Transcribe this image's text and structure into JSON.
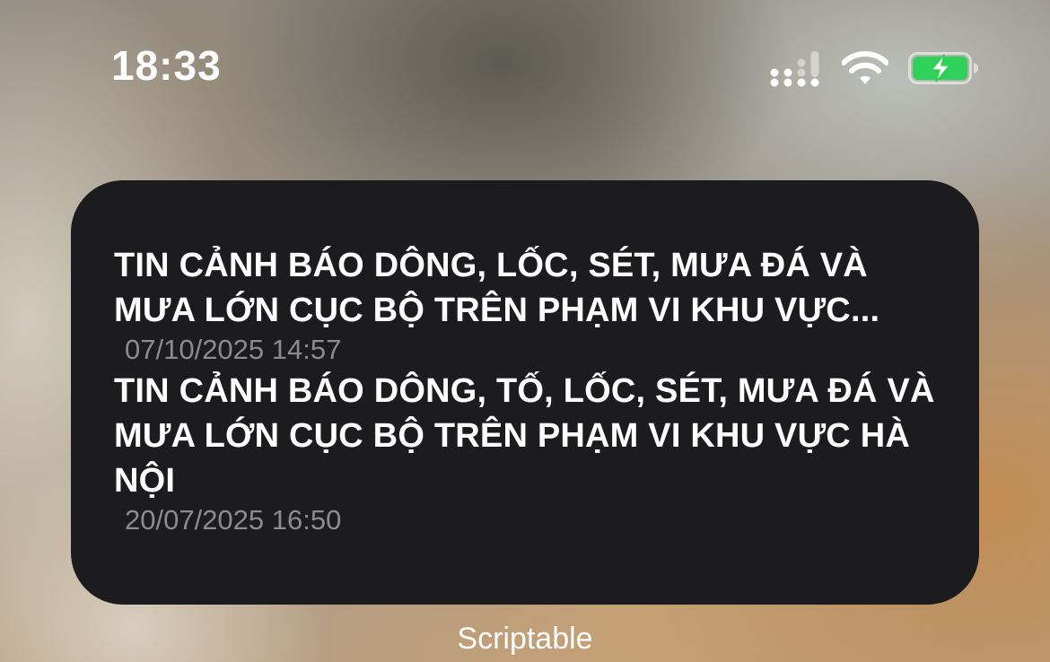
{
  "status_bar": {
    "time": "18:33",
    "icons": [
      "signal-icon",
      "wifi-icon",
      "battery-charging-icon"
    ],
    "battery_color": "#30d158"
  },
  "widget": {
    "background": "#1c1c1e",
    "alerts": [
      {
        "title": "TIN CẢNH BÁO DÔNG, LỐC, SÉT, MƯA ĐÁ VÀ MƯA LỚN CỤC BỘ TRÊN PHẠM VI KHU VỰC...",
        "time": "07/10/2025 14:57"
      },
      {
        "title": "TIN CẢNH BÁO DÔNG, TỐ, LỐC, SÉT, MƯA ĐÁ VÀ MƯA LỚN CỤC BỘ TRÊN PHẠM VI KHU VỰC HÀ NỘI",
        "time": "20/07/2025 16:50"
      }
    ]
  },
  "app_label": "Scriptable"
}
